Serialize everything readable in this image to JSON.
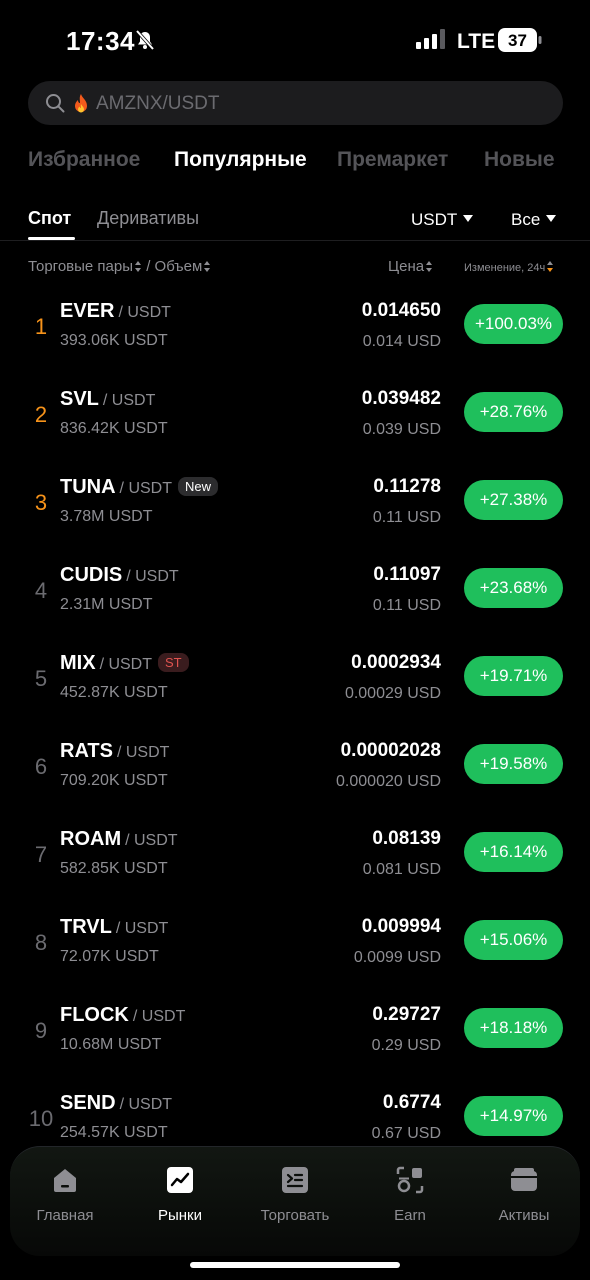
{
  "status_bar": {
    "time": "17:34",
    "network": "LTE",
    "battery": "37"
  },
  "search": {
    "placeholder": "AMZNX/USDT"
  },
  "category_tabs": [
    {
      "label": "Избранное",
      "active": false
    },
    {
      "label": "Популярные",
      "active": true
    },
    {
      "label": "Премаркет",
      "active": false
    },
    {
      "label": "Новые",
      "active": false
    }
  ],
  "sub_tabs": [
    {
      "label": "Спот",
      "active": true
    },
    {
      "label": "Деривативы",
      "active": false
    }
  ],
  "filters": {
    "quote": "USDT",
    "scope": "Все"
  },
  "columns": {
    "pairs": "Торговые пары",
    "separator": "/",
    "volume": "Объем",
    "price": "Цена",
    "change": "Изменение, 24ч"
  },
  "rows": [
    {
      "rank": "1",
      "base": "EVER",
      "quote": "/ USDT",
      "badge": "",
      "volume": "393.06K USDT",
      "price": "0.014650",
      "price_usd": "0.014 USD",
      "change": "+100.03%"
    },
    {
      "rank": "2",
      "base": "SVL",
      "quote": "/ USDT",
      "badge": "",
      "volume": "836.42K USDT",
      "price": "0.039482",
      "price_usd": "0.039 USD",
      "change": "+28.76%"
    },
    {
      "rank": "3",
      "base": "TUNA",
      "quote": "/ USDT",
      "badge": "New",
      "volume": "3.78M USDT",
      "price": "0.11278",
      "price_usd": "0.11 USD",
      "change": "+27.38%"
    },
    {
      "rank": "4",
      "base": "CUDIS",
      "quote": "/ USDT",
      "badge": "",
      "volume": "2.31M USDT",
      "price": "0.11097",
      "price_usd": "0.11 USD",
      "change": "+23.68%"
    },
    {
      "rank": "5",
      "base": "MIX",
      "quote": "/ USDT",
      "badge": "ST",
      "volume": "452.87K USDT",
      "price": "0.0002934",
      "price_usd": "0.00029 USD",
      "change": "+19.71%"
    },
    {
      "rank": "6",
      "base": "RATS",
      "quote": "/ USDT",
      "badge": "",
      "volume": "709.20K USDT",
      "price": "0.00002028",
      "price_usd": "0.000020 USD",
      "change": "+19.58%"
    },
    {
      "rank": "7",
      "base": "ROAM",
      "quote": "/ USDT",
      "badge": "",
      "volume": "582.85K USDT",
      "price": "0.08139",
      "price_usd": "0.081 USD",
      "change": "+16.14%"
    },
    {
      "rank": "8",
      "base": "TRVL",
      "quote": "/ USDT",
      "badge": "",
      "volume": "72.07K USDT",
      "price": "0.009994",
      "price_usd": "0.0099 USD",
      "change": "+15.06%"
    },
    {
      "rank": "9",
      "base": "FLOCK",
      "quote": "/ USDT",
      "badge": "",
      "volume": "10.68M USDT",
      "price": "0.29727",
      "price_usd": "0.29 USD",
      "change": "+18.18%"
    },
    {
      "rank": "10",
      "base": "SEND",
      "quote": "/ USDT",
      "badge": "",
      "volume": "254.57K USDT",
      "price": "0.6774",
      "price_usd": "0.67 USD",
      "change": "+14.97%"
    }
  ],
  "bottom_nav": [
    {
      "label": "Главная",
      "icon": "home-icon",
      "active": false
    },
    {
      "label": "Рынки",
      "icon": "markets-icon",
      "active": true
    },
    {
      "label": "Торговать",
      "icon": "trade-icon",
      "active": false
    },
    {
      "label": "Earn",
      "icon": "earn-icon",
      "active": false
    },
    {
      "label": "Активы",
      "icon": "wallet-icon",
      "active": false
    }
  ],
  "colors": {
    "positive": "#1fbf5c",
    "top_rank": "#f7931a",
    "background": "#000000"
  }
}
